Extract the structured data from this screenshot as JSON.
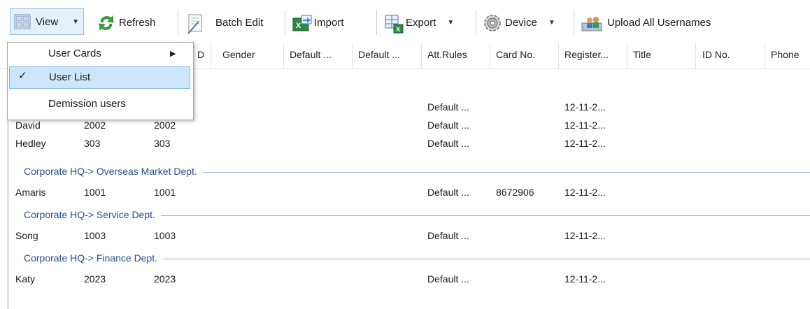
{
  "toolbar": {
    "view": "View",
    "refresh": "Refresh",
    "batch_edit": "Batch Edit",
    "import": "Import",
    "export": "Export",
    "device": "Device",
    "upload": "Upload All Usernames"
  },
  "columns": {
    "obscured": "D",
    "gender": "Gender",
    "default1": "Default ...",
    "default2": "Default ...",
    "att_rules": "Att.Rules",
    "card_no": "Card No.",
    "register": "Register...",
    "title": "Title",
    "id_no": "ID No.",
    "phone": "Phone"
  },
  "menu": {
    "user_cards": "User Cards",
    "user_list": "User List",
    "demission": "Demission users",
    "check": "✓",
    "arrow": "▶"
  },
  "rows": [
    {
      "name": "",
      "c1": "",
      "c2": "",
      "att": "Default ...",
      "card": "",
      "reg": "12-11-2..."
    },
    {
      "name": "David",
      "c1": "2002",
      "c2": "2002",
      "att": "Default ...",
      "card": "",
      "reg": "12-11-2..."
    },
    {
      "name": "Hedley",
      "c1": "303",
      "c2": "303",
      "att": "Default ...",
      "card": "",
      "reg": "12-11-2..."
    },
    {
      "name": "Amaris",
      "c1": "1001",
      "c2": "1001",
      "att": "Default ...",
      "card": "8672906",
      "reg": "12-11-2..."
    },
    {
      "name": "Song",
      "c1": "1003",
      "c2": "1003",
      "att": "Default ...",
      "card": "",
      "reg": "12-11-2..."
    },
    {
      "name": "Katy",
      "c1": "2023",
      "c2": "2023",
      "att": "Default ...",
      "card": "",
      "reg": "12-11-2..."
    }
  ],
  "groups": {
    "overseas": "Corporate HQ-> Overseas Market Dept.",
    "service": "Corporate HQ-> Service Dept.",
    "finance": "Corporate HQ-> Finance Dept."
  },
  "colors": {
    "accent": "#2a4e8c",
    "menu_selected": "#cde6fb"
  }
}
